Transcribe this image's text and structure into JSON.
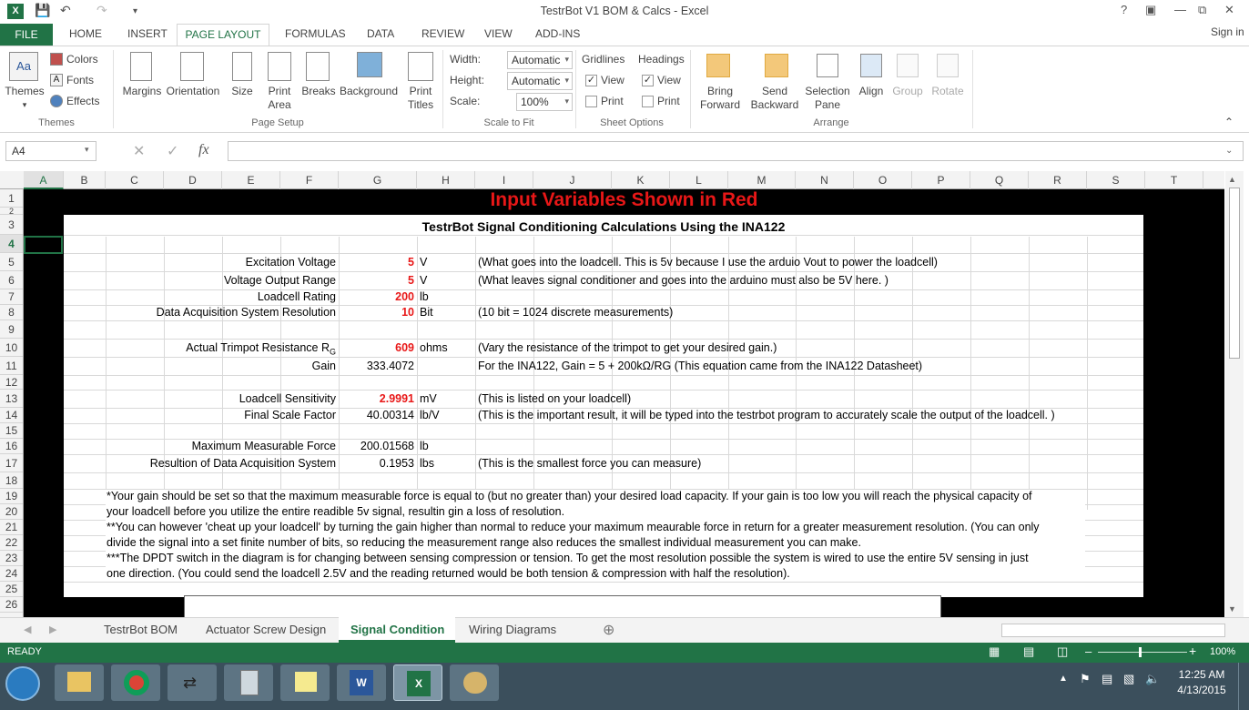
{
  "window": {
    "title": "TestrBot V1 BOM & Calcs - Excel",
    "signin": "Sign in",
    "help": "?"
  },
  "tabs": [
    "FILE",
    "HOME",
    "INSERT",
    "PAGE LAYOUT",
    "FORMULAS",
    "DATA",
    "REVIEW",
    "VIEW",
    "ADD-INS"
  ],
  "ribbon": {
    "themes": {
      "themes": "Themes",
      "colors": "Colors",
      "fonts": "Fonts",
      "effects": "Effects",
      "group": "Themes"
    },
    "page_setup": {
      "margins": "Margins",
      "orientation": "Orientation",
      "size": "Size",
      "print_area_1": "Print",
      "print_area_2": "Area",
      "breaks": "Breaks",
      "background": "Background",
      "print_titles_1": "Print",
      "print_titles_2": "Titles",
      "group": "Page Setup"
    },
    "scale": {
      "width_label": "Width:",
      "width_val": "Automatic",
      "height_label": "Height:",
      "height_val": "Automatic",
      "scale_label": "Scale:",
      "scale_val": "100%",
      "group": "Scale to Fit"
    },
    "sheet_options": {
      "gridlines": "Gridlines",
      "headings": "Headings",
      "view": "View",
      "print": "Print",
      "group": "Sheet Options"
    },
    "arrange": {
      "bring_1": "Bring",
      "bring_2": "Forward",
      "send_1": "Send",
      "send_2": "Backward",
      "sel_1": "Selection",
      "sel_2": "Pane",
      "align": "Align",
      "group_btn": "Group",
      "rotate": "Rotate",
      "group": "Arrange"
    }
  },
  "formula_bar": {
    "name_box": "A4",
    "fx": "fx",
    "formula": ""
  },
  "columns": [
    "A",
    "B",
    "C",
    "D",
    "E",
    "F",
    "G",
    "H",
    "I",
    "J",
    "K",
    "L",
    "M",
    "N",
    "O",
    "P",
    "Q",
    "R",
    "S",
    "T"
  ],
  "rows": [
    "1",
    "2",
    "3",
    "4",
    "5",
    "6",
    "7",
    "8",
    "9",
    "10",
    "11",
    "12",
    "13",
    "14",
    "15",
    "16",
    "17",
    "18",
    "19",
    "20",
    "21",
    "22",
    "23",
    "24",
    "25",
    "26"
  ],
  "sheet": {
    "banner": "Input Variables Shown in Red",
    "heading": "TestrBot Signal Conditioning Calculations Using the INA122",
    "r5": {
      "label": "Excitation Voltage",
      "value": "5",
      "unit": "V",
      "note": "(What goes into the loadcell. This is 5v because I use the arduio Vout to power the loadcell)"
    },
    "r6": {
      "label": "Voltage Output Range",
      "value": "5",
      "unit": "V",
      "note": "(What leaves signal conditioner and goes into the arduino must also be 5V here. )"
    },
    "r7": {
      "label": "Loadcell Rating",
      "value": "200",
      "unit": "lb"
    },
    "r8": {
      "label": "Data Acquisition System Resolution",
      "value": "10",
      "unit": "Bit",
      "note": "(10 bit = 1024 discrete measurements)"
    },
    "r10": {
      "label": "Actual Trimpot Resistance R",
      "sub": "G",
      "value": "609",
      "unit": "ohms",
      "note": "(Vary the resistance of the trimpot to get your desired gain.)"
    },
    "r11": {
      "label": "Gain",
      "value": "333.4072",
      "note": "For the INA122, Gain = 5 + 200kΩ/RG (This equation came from the INA122 Datasheet)"
    },
    "r13": {
      "label": "Loadcell Sensitivity",
      "value": "2.9991",
      "unit": "mV",
      "note": "(This is listed on your loadcell)"
    },
    "r14": {
      "label": "Final Scale Factor",
      "value": "40.00314",
      "unit": "lb/V",
      "note": "(This is the important result, it will be typed into the testrbot program to accurately scale the output of the loadcell. )"
    },
    "r16": {
      "label": "Maximum Measurable Force",
      "value": "200.01568",
      "unit": "lb"
    },
    "r17": {
      "label": "Resultion of Data Acquisition System",
      "value": "0.1953",
      "unit": "lbs",
      "note": "(This is the smallest force you can measure)"
    },
    "notes": [
      "*Your gain should be set so that the maximum measurable force is equal to (but no greater than) your desired load capacity. If your gain is too low you will reach the physical capacity of",
      "your loadcell before you utilize the entire readible 5v signal, resultin gin a loss of resolution.",
      "**You can however 'cheat up your loadcell' by turning the gain higher than normal to reduce your maximum meaurable force in return for a greater measurement resolution. (You can only",
      "divide the signal into a set finite number of bits, so reducing the measurement range also reduces the smallest individual measurement you can make.",
      "***The DPDT switch in the diagram is for changing between sensing compression or tension. To get the most resolution possible the system is wired to use the entire 5V sensing in just",
      "one direction. (You could send the loadcell 2.5V and the reading returned would be both tension & compression with half the resolution)."
    ]
  },
  "sheet_tabs": [
    "TestrBot BOM",
    "Actuator Screw Design",
    "Signal Condition",
    "Wiring Diagrams"
  ],
  "status": {
    "ready": "READY",
    "zoom": "100%"
  },
  "taskbar": {
    "time": "12:25 AM",
    "date": "4/13/2015"
  }
}
